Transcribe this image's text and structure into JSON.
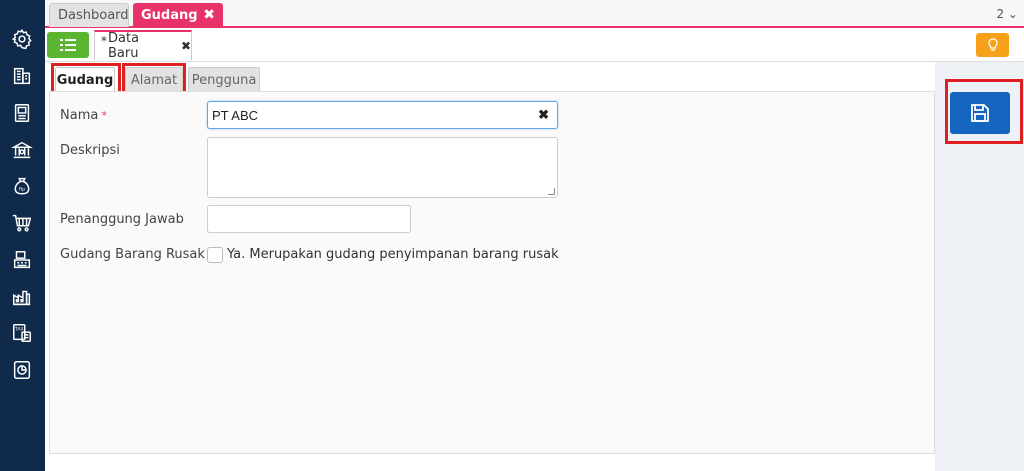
{
  "topbar": {
    "tabs": [
      {
        "label": "Dashboard"
      },
      {
        "label": "Gudang",
        "close": "✖"
      }
    ],
    "counter": "2 ⌄"
  },
  "subbar": {
    "tab": {
      "modified_marker": "*",
      "label": "Data Baru",
      "close": "✖"
    }
  },
  "form": {
    "tabs": [
      {
        "label": "Gudang"
      },
      {
        "label": "Alamat"
      },
      {
        "label": "Pengguna"
      }
    ],
    "fields": {
      "nama": {
        "label": "Nama",
        "required_marker": "*",
        "value": "PT ABC",
        "clear": "✖"
      },
      "deskripsi": {
        "label": "Deskripsi",
        "value": ""
      },
      "penanggung_jawab": {
        "label": "Penanggung Jawab",
        "value": ""
      },
      "gudang_rusak": {
        "label": "Gudang Barang Rusak",
        "checkbox_label": "Ya. Merupakan gudang penyimpanan barang rusak",
        "checked": false
      }
    }
  },
  "colors": {
    "accent": "#e8336a",
    "nav_bg": "#0f2a4a",
    "save_button": "#1565c0",
    "list_button": "#5cb531",
    "bulb_button": "#f7a11a",
    "highlight": "#e02020"
  },
  "icons": {
    "nav": [
      "gear-icon",
      "building-icon",
      "book-icon",
      "bank-icon",
      "money-bag-icon",
      "cart-icon",
      "cashier-icon",
      "factory-icon",
      "tax-calculator-icon",
      "report-chart-icon"
    ],
    "list_button": "list-icon",
    "bulb_button": "lightbulb-icon",
    "save_button": "floppy-disk-icon"
  }
}
